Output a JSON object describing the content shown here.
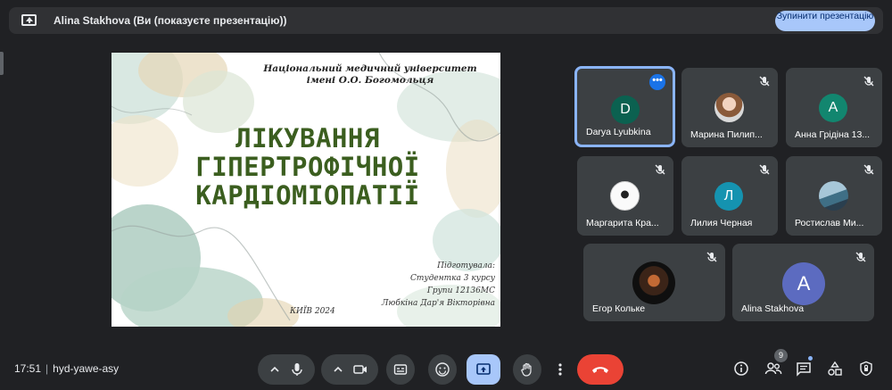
{
  "banner": {
    "title": "Alina Stakhova (Ви (показуєте презентацію))",
    "stop_button": "Зупинити презентацію"
  },
  "slide": {
    "university_line1": "Національний медичний університет",
    "university_line2": "імені О.О. Богомольця",
    "headline_line1": "ЛІКУВАННЯ",
    "headline_line2": "ГІПЕРТРОФІЧНОЇ",
    "headline_line3": "КАРДІОМІОПАТІЇ",
    "author_line1": "Підготувала:",
    "author_line2": "Студентка 3 курсу",
    "author_line3": "Групи 12136МС",
    "author_line4": "Любкіна Дар'я Вікторівна",
    "city_year": "КИЇВ 2024"
  },
  "participants": [
    {
      "name": "Darya Lyubkina",
      "initial": "D",
      "avatar_color": "#0b6150",
      "active": true
    },
    {
      "name": "Марина Пилип...",
      "initial": "",
      "avatar_color": "",
      "muted": true
    },
    {
      "name": "Анна Грідіна 13...",
      "initial": "А",
      "avatar_color": "#12866f",
      "muted": true
    },
    {
      "name": "Маргарита Кра...",
      "initial": "",
      "avatar_color": "",
      "muted": true
    },
    {
      "name": "Лилия Черная",
      "initial": "Л",
      "avatar_color": "#1593b0",
      "muted": true
    },
    {
      "name": "Ростислав Ми...",
      "initial": "",
      "avatar_color": "",
      "muted": true
    },
    {
      "name": "Егор Кольке",
      "initial": "",
      "avatar_color": "",
      "muted": true
    },
    {
      "name": "Alina Stakhova",
      "initial": "A",
      "avatar_color": "#5c6bc0",
      "muted": true
    }
  ],
  "meeting": {
    "time": "17:51",
    "code": "hyd-yawe-asy",
    "people_count": "9"
  },
  "colors": {
    "background": "#202124",
    "tile": "#3c4043",
    "accent_blue": "#a8c7fa",
    "end_call_red": "#ea4335",
    "slide_title_green": "#3b5e1f"
  },
  "icons": [
    "present-icon",
    "mic-off-icon",
    "more-icon",
    "chevron-up-icon",
    "mic-icon",
    "camera-icon",
    "captions-icon",
    "emoji-icon",
    "present-now-icon",
    "hand-icon",
    "end-call-icon",
    "info-icon",
    "people-icon",
    "chat-icon",
    "activities-icon",
    "host-controls-icon"
  ]
}
